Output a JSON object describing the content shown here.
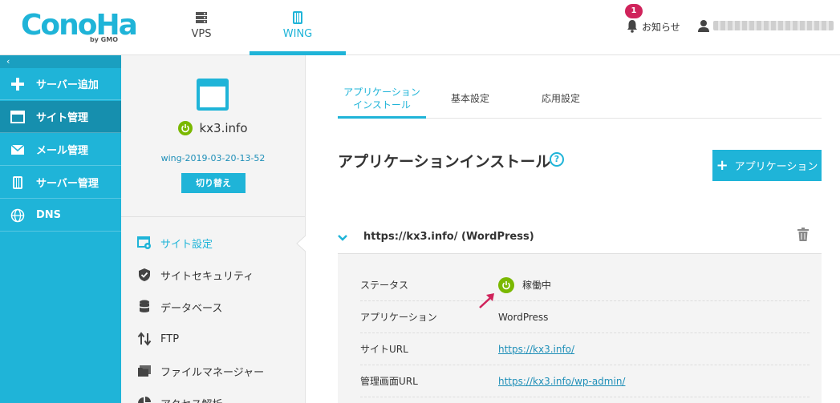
{
  "header": {
    "logo": "ConoHa",
    "logo_by": "by GMO",
    "tabs": [
      {
        "label": "VPS",
        "icon": "server-icon"
      },
      {
        "label": "WING",
        "icon": "wing-icon"
      }
    ],
    "notification_count": "1",
    "notification_label": "お知らせ"
  },
  "sidebar": {
    "collapse_label": "‹",
    "items": [
      {
        "label": "サーバー追加",
        "icon": "plus-icon"
      },
      {
        "label": "サイト管理",
        "icon": "window-icon"
      },
      {
        "label": "メール管理",
        "icon": "mail-icon"
      },
      {
        "label": "サーバー管理",
        "icon": "server-icon"
      },
      {
        "label": "DNS",
        "icon": "globe-icon"
      }
    ]
  },
  "site": {
    "name": "kx3.info",
    "id": "wing-2019-03-20-13-52",
    "switch_label": "切り替え"
  },
  "site_menu": [
    {
      "label": "サイト設定",
      "icon": "site-settings-icon"
    },
    {
      "label": "サイトセキュリティ",
      "icon": "shield-icon"
    },
    {
      "label": "データベース",
      "icon": "database-icon"
    },
    {
      "label": "FTP",
      "icon": "transfer-icon"
    },
    {
      "label": "ファイルマネージャー",
      "icon": "folder-icon"
    },
    {
      "label": "アクセス解析",
      "icon": "pie-chart-icon"
    }
  ],
  "main": {
    "tabs": [
      {
        "label_line1": "アプリケーション",
        "label_line2": "インストール"
      },
      {
        "label": "基本設定"
      },
      {
        "label": "応用設定"
      }
    ],
    "title": "アプリケーションインストール",
    "help": "?",
    "add_app_label": "アプリケーション",
    "app": {
      "url": "https://kx3.info/ (WordPress)",
      "rows": [
        {
          "label": "ステータス",
          "value": "稼働中"
        },
        {
          "label": "アプリケーション",
          "value": "WordPress"
        },
        {
          "label": "サイトURL",
          "value": "https://kx3.info/"
        },
        {
          "label": "管理画面URL",
          "value": "https://kx3.info/wp-admin/"
        }
      ]
    }
  },
  "colors": {
    "brand": "#1fb4d8",
    "status_on": "#7ab800",
    "badge": "#d0235b"
  }
}
